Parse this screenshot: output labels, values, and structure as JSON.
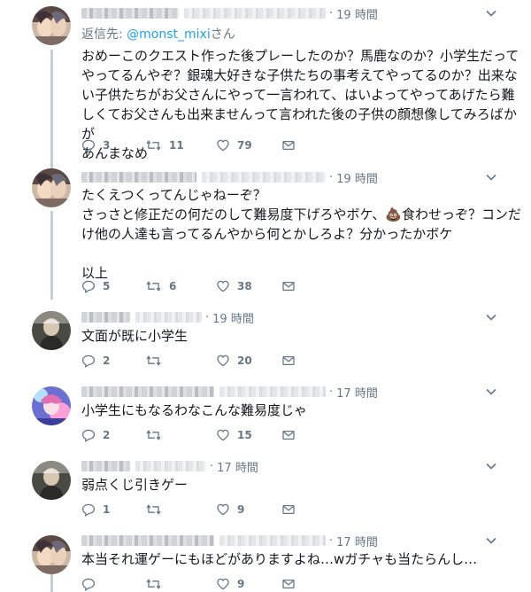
{
  "reply_prefix": "返信先:",
  "reply_handle": "@monst_mixi",
  "reply_suffix": "さん",
  "tweets": [
    {
      "time": "19 時間",
      "text": "おめーこのクエスト作った後プレーしたのか？馬鹿なのか？小学生だってやってるんやぞ？銀魂大好きな子供たちの事考えてやってるのか？出来ない子供たちがお父さんにやって一言われて、はいよってやってあげたら難しくてお父さんも出来ませんって言われた後の子供の顔想像してみろばかが\nあんまなめ",
      "replies": "3",
      "retweets": "11",
      "likes": "79"
    },
    {
      "time": "19 時間",
      "text_a": "たくえつくってんじゃねーぞ？\nさっさと修正だの何だのして難易度下げろやボケ、",
      "text_b": "食わせっぞ？コンだけ他の人達も言ってるんやから何とかしろよ？分かったかボケ\n\n以上",
      "emoji": "💩",
      "replies": "5",
      "retweets": "6",
      "likes": "38"
    },
    {
      "time": "19 時間",
      "text": "文面が既に小学生",
      "replies": "2",
      "retweets": "",
      "likes": "20"
    },
    {
      "time": "17 時間",
      "text": "小学生にもなるわなこんな難易度じゃ",
      "replies": "2",
      "retweets": "",
      "likes": "15"
    },
    {
      "time": "17 時間",
      "text": "弱点くじ引きゲー",
      "replies": "1",
      "retweets": "",
      "likes": "9"
    },
    {
      "time": "17 時間",
      "text": "本当それ運ゲーにもほどがありますよね…wガチャも当たらんし…",
      "replies": "",
      "retweets": "",
      "likes": "9"
    }
  ],
  "icons": {
    "reply": "reply-icon",
    "retweet": "retweet-icon",
    "like": "heart-icon",
    "dm": "dm-icon",
    "menu": "chevron-down-icon"
  },
  "colors": {
    "accent": "#1da1f2",
    "muted": "#657786",
    "thread": "#c4cfd6"
  }
}
